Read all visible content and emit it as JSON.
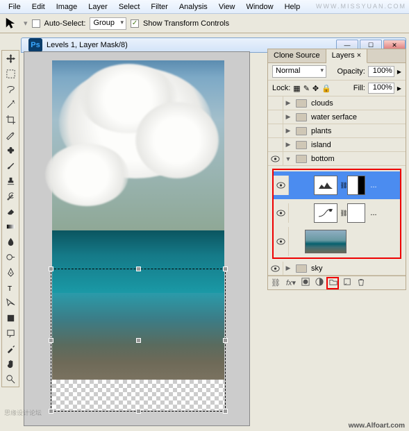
{
  "menubar": [
    "File",
    "Edit",
    "Image",
    "Layer",
    "Select",
    "Filter",
    "Analysis",
    "View",
    "Window",
    "Help"
  ],
  "options": {
    "auto_select_label": "Auto-Select:",
    "group_select": "Group",
    "show_transform_label": "Show Transform Controls"
  },
  "window": {
    "title": "Levels 1, Layer Mask/8)"
  },
  "panels": {
    "tabs": [
      "Clone Source",
      "Layers"
    ],
    "active_tab": 1,
    "blend_mode": "Normal",
    "opacity_label": "Opacity:",
    "opacity_value": "100%",
    "lock_label": "Lock:",
    "fill_label": "Fill:",
    "fill_value": "100%",
    "layers": [
      {
        "name": "clouds",
        "visible": false,
        "expanded": false
      },
      {
        "name": "water serface",
        "visible": false,
        "expanded": false
      },
      {
        "name": "plants",
        "visible": false,
        "expanded": false
      },
      {
        "name": "island",
        "visible": false,
        "expanded": false
      },
      {
        "name": "bottom",
        "visible": true,
        "expanded": true
      },
      {
        "name": "sky",
        "visible": true,
        "expanded": false
      }
    ]
  },
  "footer": {
    "site": "www.Alfoart.com"
  },
  "watermarks": {
    "top": "WWW.MISSYUAN.COM",
    "bottom": "思缘设计论坛"
  }
}
